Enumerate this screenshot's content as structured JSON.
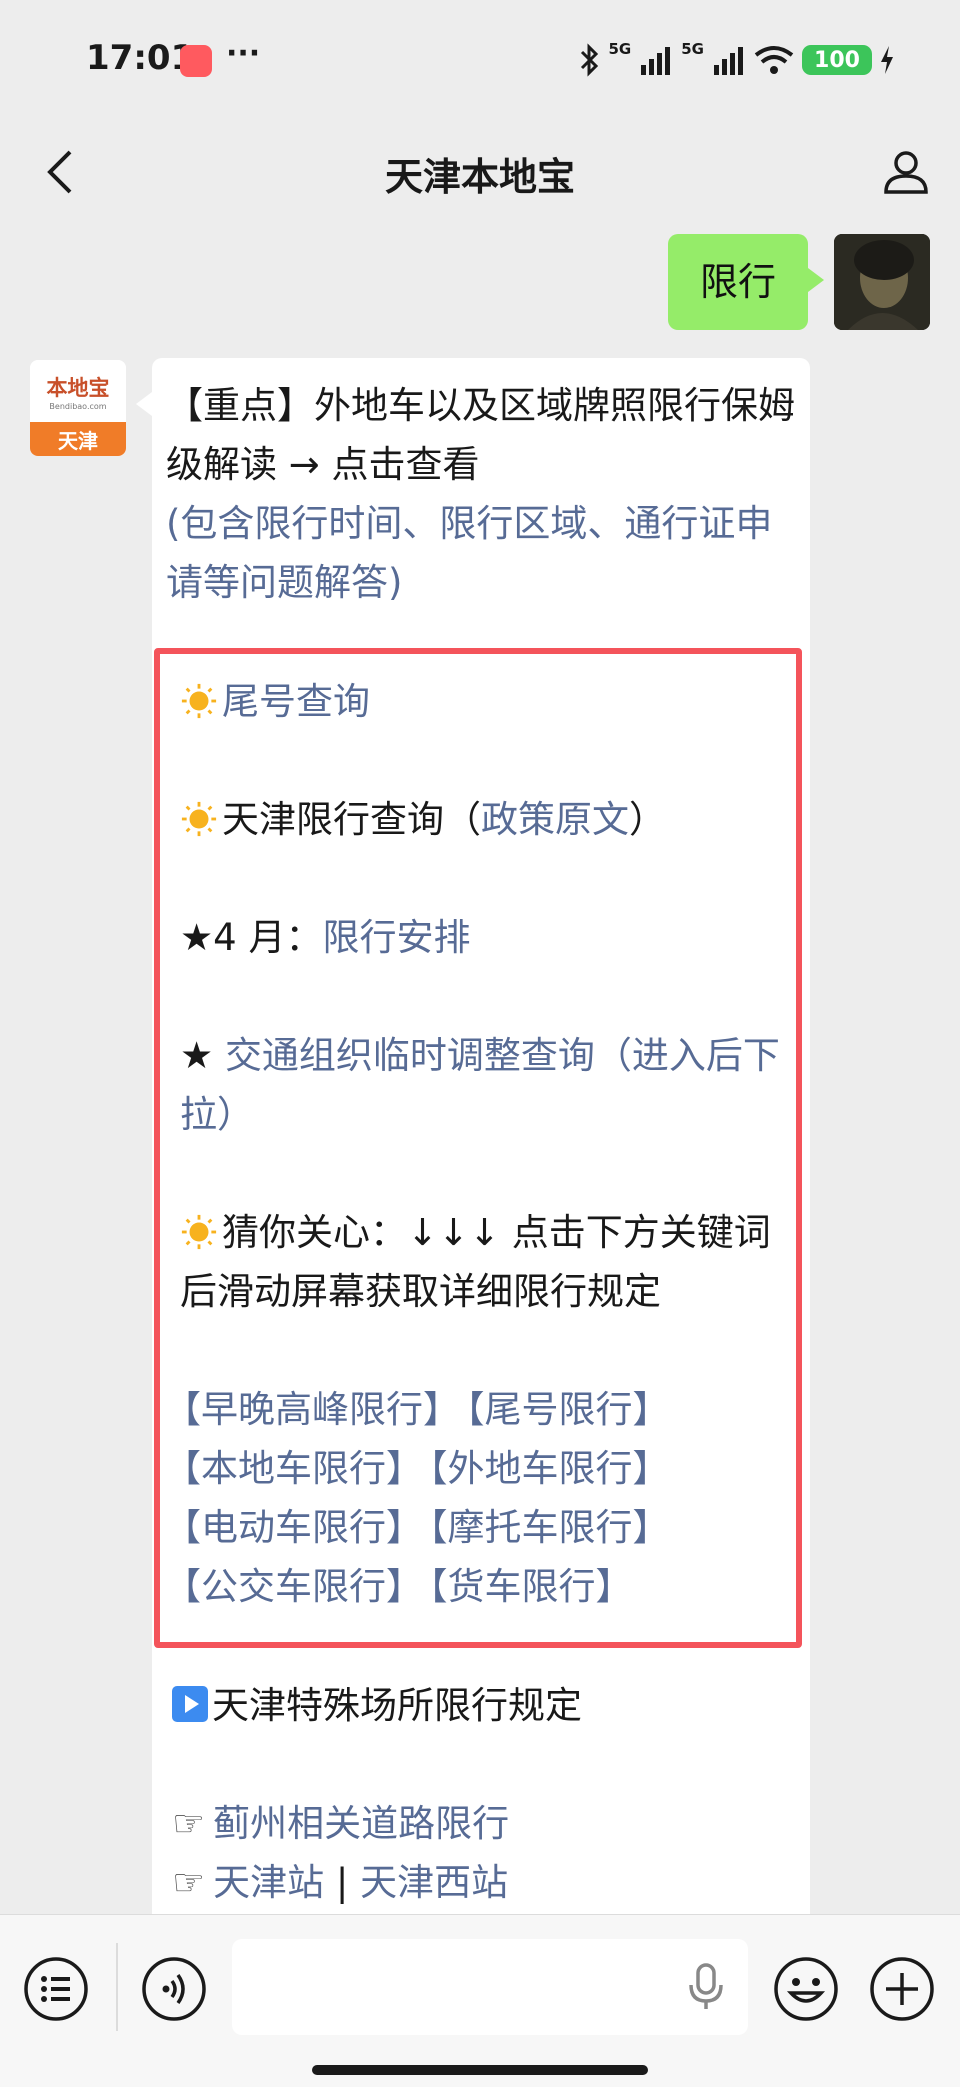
{
  "status_bar": {
    "time": "17:01",
    "dots": "···",
    "net_a": "5G",
    "net_b": "5G",
    "battery": "100"
  },
  "nav": {
    "title": "天津本地宝"
  },
  "user_message": "限行",
  "bot": {
    "avatar_brand": "本地宝",
    "avatar_sub": "Bendibao.com",
    "avatar_city": "天津",
    "head_text": "【重点】外地车以及区域牌照限行保姆级解读 → 点击查看",
    "head_note": "(包含限行时间、限行区域、通行证申请等问题解答)",
    "tail_query": "尾号查询",
    "tianjin_query": "天津限行查询（",
    "policy_text": "政策原文",
    "close_paren": "）",
    "april_prefix": "★4 月：",
    "april_link": "限行安排",
    "star": "★ ",
    "traffic_link": "交通组织临时调整查询（进入后下拉）",
    "care_text": "猜你关心：↓↓↓ 点击下方关键词后滑动屏幕获取详细限行规定",
    "tags": [
      [
        "【早晚高峰限行】",
        "【尾号限行】"
      ],
      [
        "【本地车限行】",
        "【外地车限行】"
      ],
      [
        "【电动车限行】",
        "【摩托车限行】"
      ],
      [
        "【公交车限行】",
        "【货车限行】"
      ]
    ],
    "special_title": "天津特殊场所限行规定",
    "hand": "☞",
    "jizhou_link": "蓟州相关道路限行",
    "station_link": "天津站",
    "separator": " | ",
    "west_station_link": "天津西站"
  },
  "input": {
    "value": "",
    "placeholder": ""
  },
  "colors": {
    "background": "#ededed",
    "user_bubble": "#95ec69",
    "link": "#576b95",
    "highlight_border": "#f4545b",
    "battery": "#3cc55a"
  },
  "icons": [
    "back-arrow-icon",
    "person-icon",
    "menu-list-icon",
    "voice-icon",
    "microphone-icon",
    "emoji-icon",
    "plus-icon",
    "sun-icon",
    "play-icon"
  ]
}
